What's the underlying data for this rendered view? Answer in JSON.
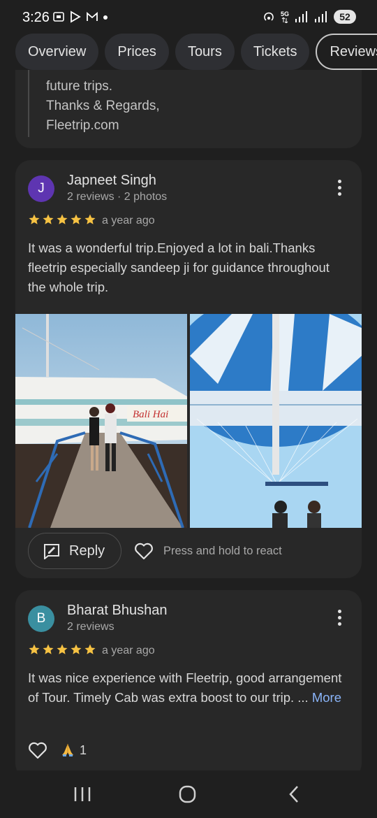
{
  "status_bar": {
    "time": "3:26",
    "network": "5G",
    "battery": "52"
  },
  "tabs": [
    "Overview",
    "Prices",
    "Tours",
    "Tickets",
    "Reviews"
  ],
  "active_tab": "Reviews",
  "owner_reply": {
    "lines": [
      "future trips.",
      "Thanks & Regards,",
      "Fleetrip.com"
    ]
  },
  "reviews": [
    {
      "avatar_letter": "J",
      "avatar_color": "#5e35b1",
      "name": "Japneet Singh",
      "meta": "2 reviews · 2 photos",
      "rating": 5,
      "time_ago": "a year ago",
      "text": "It was a wonderful trip.Enjoyed a lot in bali.Thanks fleetrip especially sandeep ji for guidance throughout the whole trip.",
      "photo_sign": "Bali Hai",
      "reply_label": "Reply",
      "react_hint": "Press and hold to react"
    },
    {
      "avatar_letter": "B",
      "avatar_color": "#3a8fa0",
      "name": "Bharat Bhushan",
      "meta": "2 reviews",
      "rating": 5,
      "time_ago": "a year ago",
      "text": "It was nice experience with Fleetrip, good arrangement of Tour. Timely Cab was extra boost to our trip. ...",
      "more_label": "More",
      "reaction_count": "1"
    }
  ],
  "colors": {
    "star": "#f6c243",
    "link": "#8ab4f8",
    "card": "#282828",
    "background": "#1f1f1f"
  }
}
